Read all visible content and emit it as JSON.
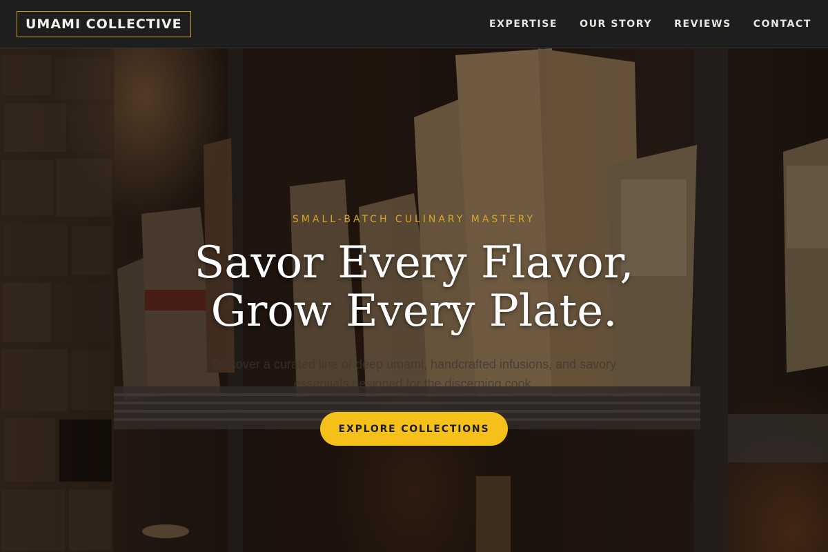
{
  "header": {
    "brand": "UMAMI COLLECTIVE",
    "nav": [
      {
        "label": "EXPERTISE"
      },
      {
        "label": "OUR STORY"
      },
      {
        "label": "REVIEWS"
      },
      {
        "label": "CONTACT"
      }
    ]
  },
  "hero": {
    "eyebrow": "SMALL-BATCH CULINARY MASTERY",
    "headline_line1": "Savor Every Flavor,",
    "headline_line2": "Grow Every Plate.",
    "subtext": "Discover a curated line of deep umami, handcrafted infusions, and savory essentials designed for the discerning cook.",
    "cta_label": "EXPLORE COLLECTIONS"
  },
  "colors": {
    "accent": "#f5c01a",
    "eyebrow": "#d9a62a",
    "header_bg": "#1e1e1e",
    "logo_border": "#c9a227"
  }
}
